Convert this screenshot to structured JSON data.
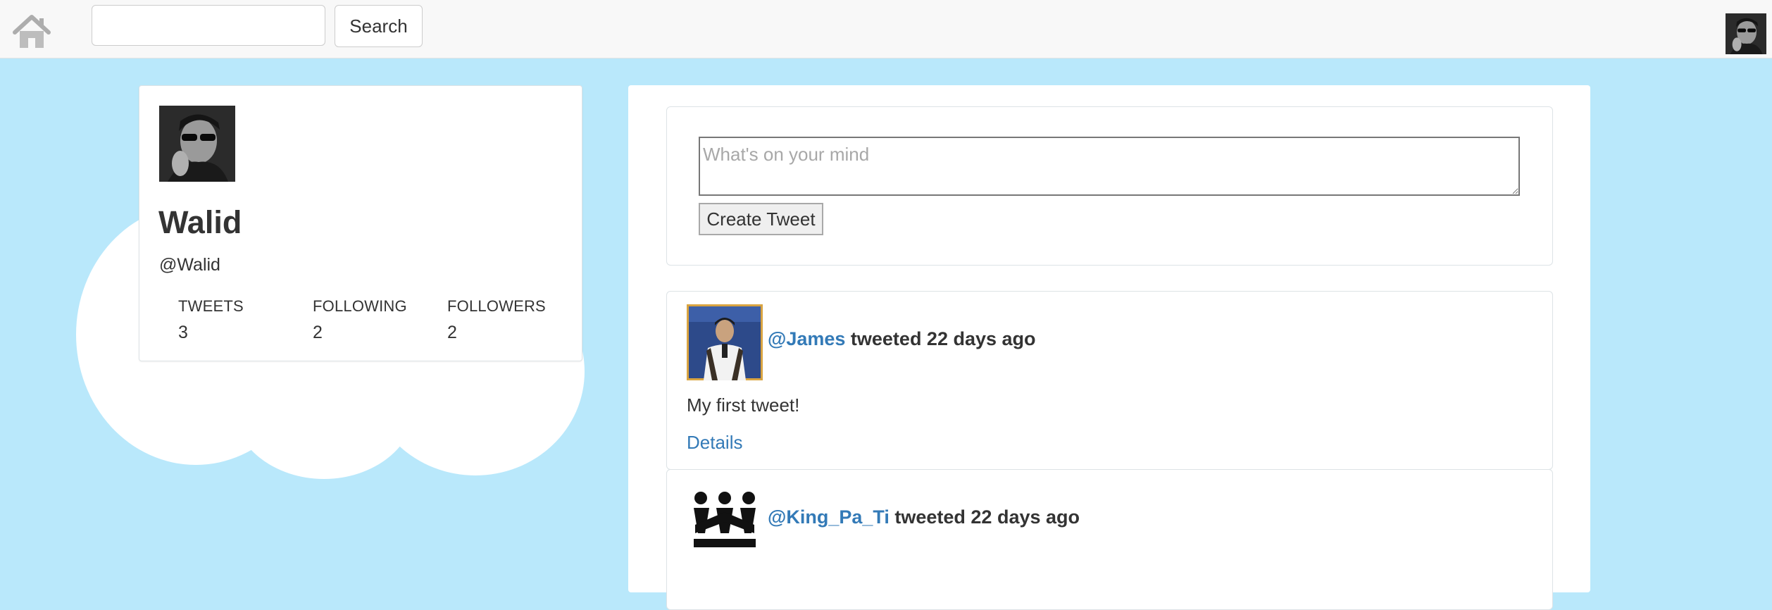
{
  "navbar": {
    "search_value": "",
    "search_button_label": "Search"
  },
  "profile": {
    "name": "Walid",
    "handle": "@Walid",
    "stats": [
      {
        "label": "TWEETS",
        "value": "3"
      },
      {
        "label": "FOLLOWING",
        "value": "2"
      },
      {
        "label": "FOLLOWERS",
        "value": "2"
      }
    ]
  },
  "compose": {
    "placeholder": "What's on your mind",
    "button_label": "Create Tweet"
  },
  "tweets": [
    {
      "author": "@James",
      "meta": " tweeted 22 days ago",
      "text": "My first tweet!",
      "details_label": "Details"
    },
    {
      "author": "@King_Pa_Ti",
      "meta": " tweeted 22 days ago"
    }
  ],
  "colors": {
    "page_background": "#b9e8fb",
    "link": "#337ab7",
    "navbar": "#f8f8f8"
  }
}
